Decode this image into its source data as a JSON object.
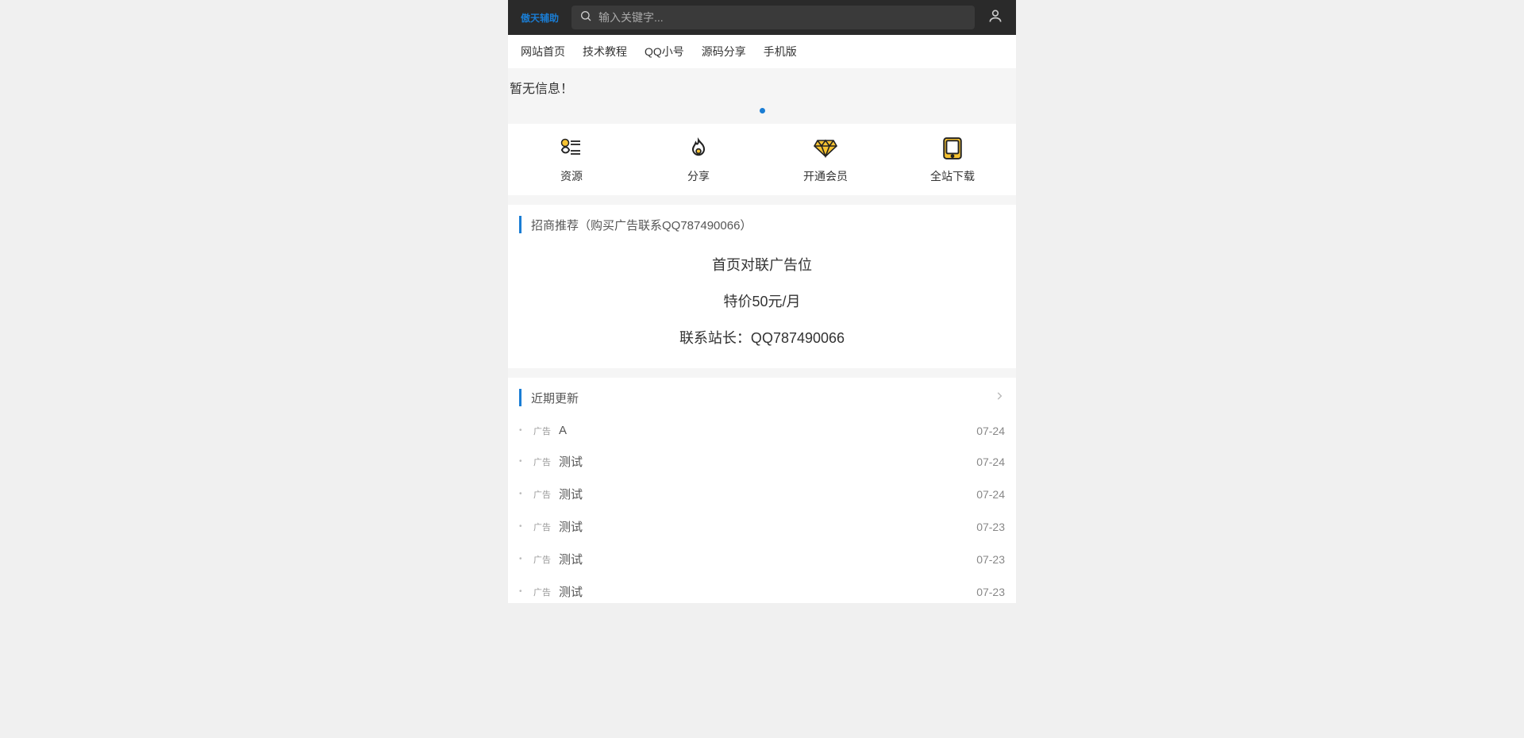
{
  "header": {
    "logo": "傲天辅助",
    "search_placeholder": "输入关键字..."
  },
  "nav": {
    "items": [
      "网站首页",
      "技术教程",
      "QQ小号",
      "源码分享",
      "手机版"
    ]
  },
  "no_info": "暂无信息！",
  "features": [
    {
      "icon": "resources-icon",
      "label": "资源"
    },
    {
      "icon": "flame-icon",
      "label": "分享"
    },
    {
      "icon": "diamond-icon",
      "label": "开通会员"
    },
    {
      "icon": "download-icon",
      "label": "全站下载"
    }
  ],
  "promo": {
    "title": "招商推荐（购买广告联系QQ787490066）",
    "lines": [
      "首页对联广告位",
      "特价50元/月",
      "联系站长：QQ787490066"
    ]
  },
  "updates": {
    "title": "近期更新",
    "tag_label": "广告",
    "items": [
      {
        "title": "A",
        "date": "07-24"
      },
      {
        "title": "测试",
        "date": "07-24"
      },
      {
        "title": "测试",
        "date": "07-24"
      },
      {
        "title": "测试",
        "date": "07-23"
      },
      {
        "title": "测试",
        "date": "07-23"
      },
      {
        "title": "测试",
        "date": "07-23"
      }
    ]
  }
}
